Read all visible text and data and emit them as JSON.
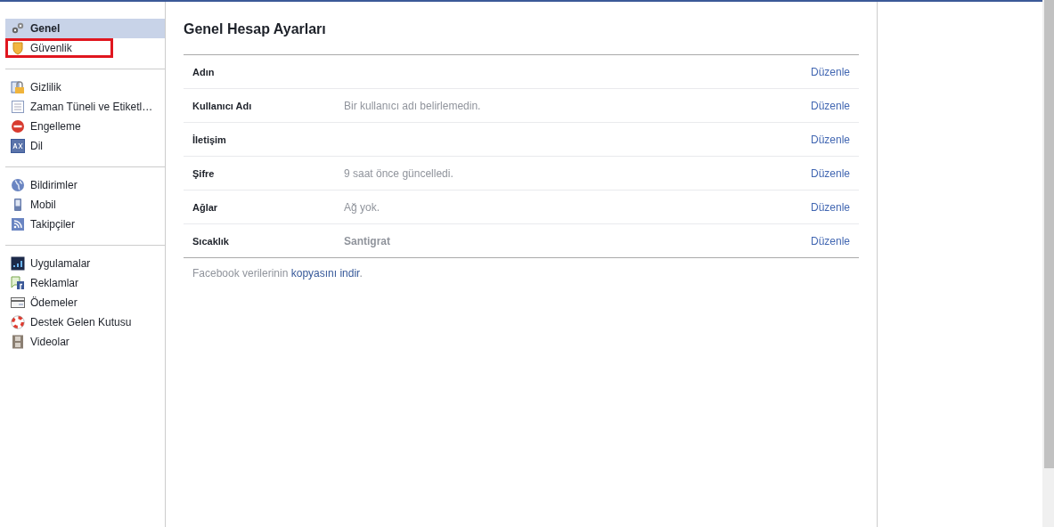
{
  "sidebar": {
    "groups": [
      {
        "items": [
          {
            "label": "Genel",
            "kind": "gears",
            "selected": true,
            "highlighted": false
          },
          {
            "label": "Güvenlik",
            "kind": "shield",
            "selected": false,
            "highlighted": true
          }
        ]
      },
      {
        "items": [
          {
            "label": "Gizlilik",
            "kind": "lock",
            "selected": false,
            "highlighted": false
          },
          {
            "label": "Zaman Tüneli ve Etiketl…",
            "kind": "timeline",
            "selected": false,
            "highlighted": false
          },
          {
            "label": "Engelleme",
            "kind": "block",
            "selected": false,
            "highlighted": false
          },
          {
            "label": "Dil",
            "kind": "language",
            "selected": false,
            "highlighted": false
          }
        ]
      },
      {
        "items": [
          {
            "label": "Bildirimler",
            "kind": "globe",
            "selected": false,
            "highlighted": false
          },
          {
            "label": "Mobil",
            "kind": "phone",
            "selected": false,
            "highlighted": false
          },
          {
            "label": "Takipçiler",
            "kind": "rss",
            "selected": false,
            "highlighted": false
          }
        ]
      },
      {
        "items": [
          {
            "label": "Uygulamalar",
            "kind": "apps",
            "selected": false,
            "highlighted": false
          },
          {
            "label": "Reklamlar",
            "kind": "ads",
            "selected": false,
            "highlighted": false
          },
          {
            "label": "Ödemeler",
            "kind": "card",
            "selected": false,
            "highlighted": false
          },
          {
            "label": "Destek Gelen Kutusu",
            "kind": "lifebuoy",
            "selected": false,
            "highlighted": false
          },
          {
            "label": "Videolar",
            "kind": "film",
            "selected": false,
            "highlighted": false
          }
        ]
      }
    ]
  },
  "main": {
    "title": "Genel Hesap Ayarları",
    "rows": [
      {
        "label": "Adın",
        "edit": "Düzenle"
      },
      {
        "label": "Kullanıcı Adı",
        "value": "Bir kullanıcı adı belirlemedin.",
        "edit": "Düzenle",
        "emphasis": false
      },
      {
        "label": "İletişim",
        "edit": "Düzenle"
      },
      {
        "label": "Şifre",
        "value": "9 saat önce güncelledi.",
        "edit": "Düzenle",
        "emphasis": false
      },
      {
        "label": "Ağlar",
        "value": "Ağ yok.",
        "edit": "Düzenle",
        "emphasis": false
      },
      {
        "label": "Sıcaklık",
        "value": "Santigrat",
        "edit": "Düzenle",
        "emphasis": true
      }
    ],
    "footer": {
      "before": "Facebook verilerinin ",
      "link": "kopyasını indir",
      "after": "."
    }
  }
}
